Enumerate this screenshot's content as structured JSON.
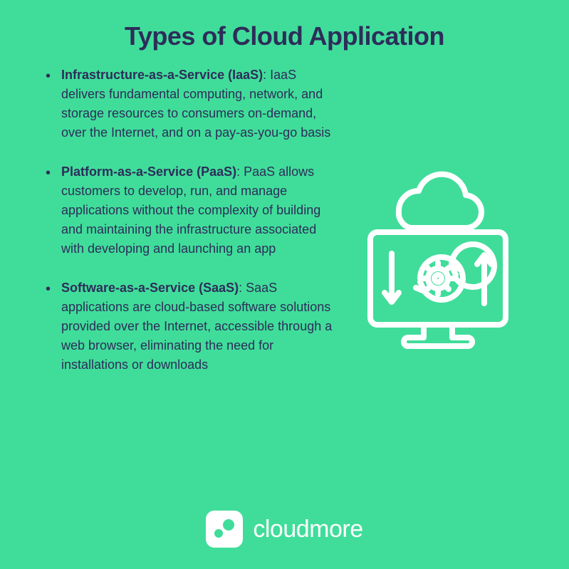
{
  "title": "Types of Cloud Application",
  "items": [
    {
      "term": "Infrastructure-as-a-Service (IaaS)",
      "desc": ": IaaS delivers fundamental computing, network, and storage resources to consumers on-demand, over the Internet, and on a pay-as-you-go basis"
    },
    {
      "term": "Platform-as-a-Service (PaaS)",
      "desc": ": PaaS allows customers to develop, run, and manage applications without the complexity of building and maintaining the infrastructure associated with developing and launching an app"
    },
    {
      "term": "Software-as-a-Service (SaaS)",
      "desc": ": SaaS applications are cloud-based software solutions provided over the Internet, accessible through a web browser, eliminating the need for installations or downloads"
    }
  ],
  "brand": "cloudmore",
  "colors": {
    "bg": "#40dd9a",
    "text": "#2d2d5a",
    "icon": "#ffffff"
  }
}
